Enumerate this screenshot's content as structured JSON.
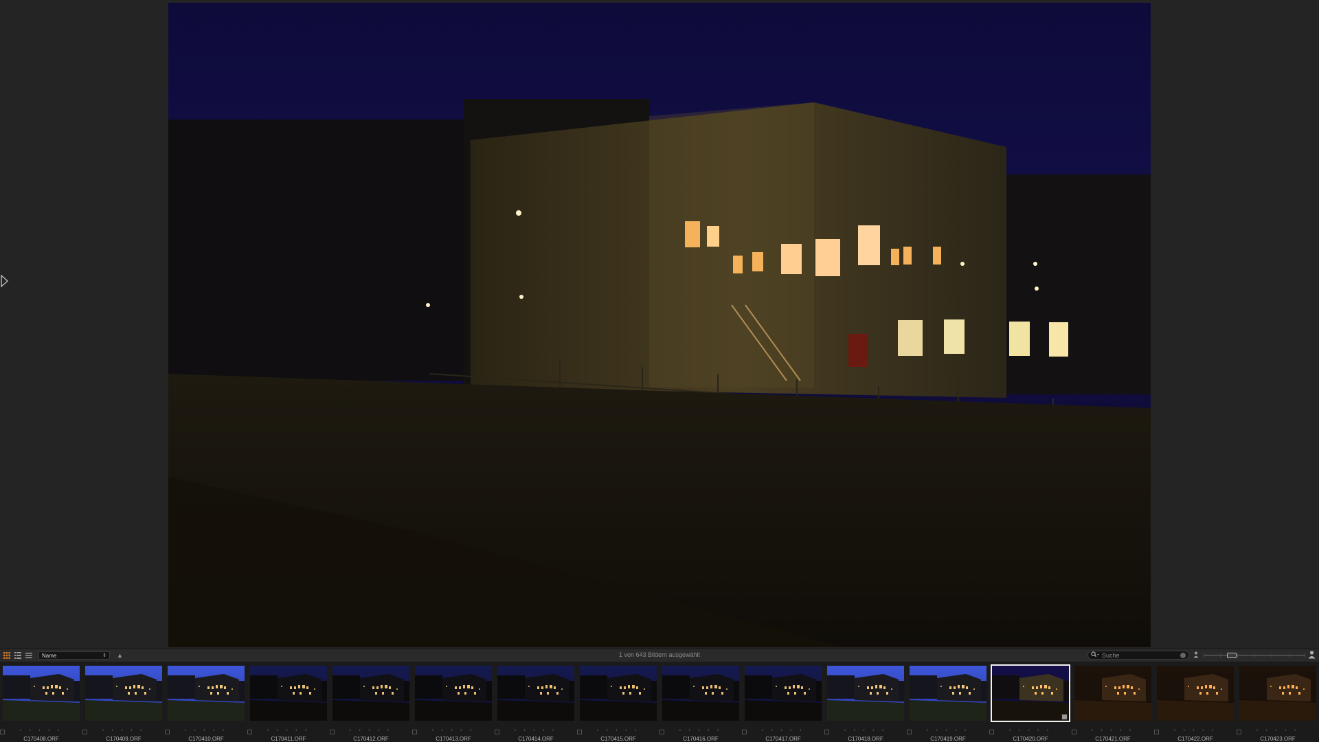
{
  "toolbar": {
    "sort_value": "Name",
    "sort_arrows": "⇕",
    "sort_direction": "▲",
    "status": "1 von 643 Bildern ausgewählt",
    "search_placeholder": "Suche"
  },
  "icons": {
    "view_grid": "grid-view-icon",
    "view_list": "list-view-icon",
    "view_columns": "columns-view-icon",
    "search": "search-icon",
    "person": "person-icon",
    "sidebar_toggle": "triangle-right-icon"
  },
  "colors": {
    "background": "#232323",
    "filmstrip": "#1b1b1b",
    "selection": "#f2f2f2",
    "sky_dusk": "#1c1a6e",
    "sky_night": "#0b0a2e",
    "window_light": "#f6b25a"
  },
  "filmstrip": {
    "thumbnails": [
      {
        "filename": "C170408.ORF",
        "stars": "• • • • •",
        "scene": "dusk"
      },
      {
        "filename": "C170409.ORF",
        "stars": "• • • • •",
        "scene": "dusk"
      },
      {
        "filename": "C170410.ORF",
        "stars": "• • • • •",
        "scene": "dusk"
      },
      {
        "filename": "C170411.ORF",
        "stars": "• • • • •",
        "scene": "dark"
      },
      {
        "filename": "C170412.ORF",
        "stars": "• • • • •",
        "scene": "dark"
      },
      {
        "filename": "C170413.ORF",
        "stars": "• • • • •",
        "scene": "dark"
      },
      {
        "filename": "C170414.ORF",
        "stars": "• • • • •",
        "scene": "dark"
      },
      {
        "filename": "C170415.ORF",
        "stars": "• • • • •",
        "scene": "dark"
      },
      {
        "filename": "C170416.ORF",
        "stars": "• • • • •",
        "scene": "dark"
      },
      {
        "filename": "C170417.ORF",
        "stars": "• • • • •",
        "scene": "dark"
      },
      {
        "filename": "C170418.ORF",
        "stars": "• • • • •",
        "scene": "dusk"
      },
      {
        "filename": "C170419.ORF",
        "stars": "• • • • •",
        "scene": "dusk"
      },
      {
        "filename": "C170420.ORF",
        "stars": "• • • • •",
        "scene": "night-lit",
        "selected": true
      },
      {
        "filename": "C170421.ORF",
        "stars": "• • • • •",
        "scene": "warm"
      },
      {
        "filename": "C170422.ORF",
        "stars": "• • • • •",
        "scene": "warm"
      },
      {
        "filename": "C170423.ORF",
        "stars": "• • • • •",
        "scene": "warm"
      }
    ]
  }
}
